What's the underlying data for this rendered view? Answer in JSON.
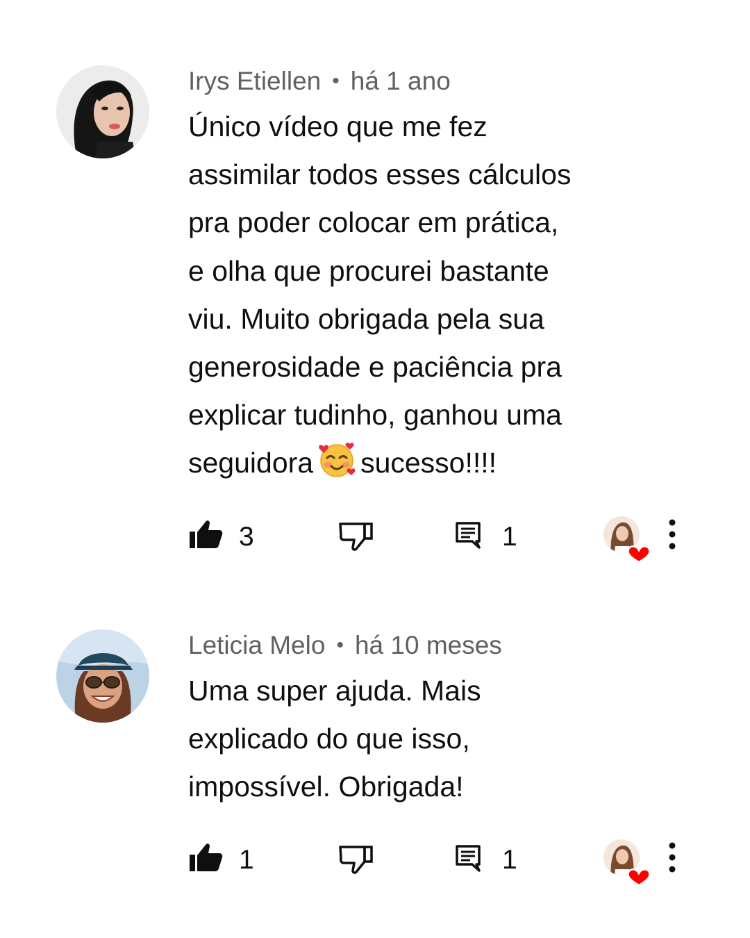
{
  "comments": [
    {
      "author": "Irys Etiellen",
      "time": "há 1 ano",
      "text_lines": [
        "Único vídeo que me fez",
        "assimilar todos esses cálculos",
        "pra poder colocar em prática,",
        "e olha que procurei bastante",
        "viu. Muito obrigada pela sua",
        "generosidade e paciência pra",
        "explicar tudinho, ganhou uma"
      ],
      "last_line_before_emoji": "seguidora",
      "emoji": "smiling-face-with-hearts",
      "last_line_after_emoji": "sucesso!!!!",
      "likes": "3",
      "replies": "1",
      "creator_hearted": true
    },
    {
      "author": "Leticia Melo",
      "time": "há 10 meses",
      "text_lines": [
        "Uma super ajuda. Mais",
        "explicado do que isso,",
        "impossível. Obrigada!"
      ],
      "likes": "1",
      "replies": "1",
      "creator_hearted": true
    }
  ],
  "separator": "•",
  "icons": {
    "like": "thumbs-up-filled-icon",
    "dislike": "thumbs-down-outline-icon",
    "reply": "comment-reply-icon",
    "heart": "creator-heart-icon",
    "more": "more-vertical-icon"
  },
  "colors": {
    "meta_text": "#606060",
    "body_text": "#0f0f0f",
    "heart": "#ff0000"
  }
}
